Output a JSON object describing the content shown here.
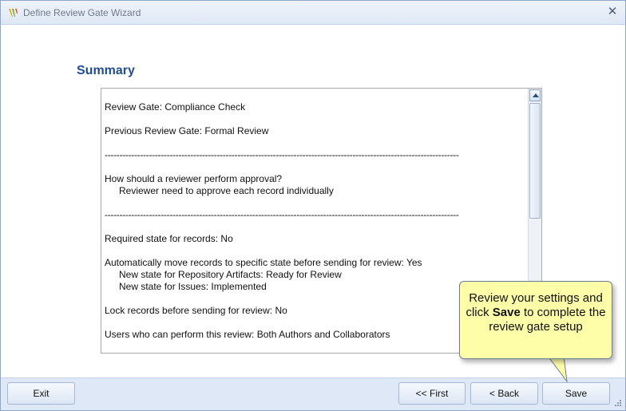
{
  "window": {
    "title": "Define Review Gate Wizard"
  },
  "page": {
    "heading": "Summary"
  },
  "summary": {
    "review_gate": "Review Gate: Compliance Check",
    "previous_gate": "Previous Review Gate: Formal Review",
    "separator": "------------------------------------------------------------------------------------------------------------------------",
    "approval_question": "How should a reviewer perform approval?",
    "approval_answer": "Reviewer need to approve each record individually",
    "required_state": "Required state for records: No",
    "auto_move": "Automatically move records to specific state before sending for review: Yes",
    "new_state_artifacts": "New state for Repository Artifacts: Ready for Review",
    "new_state_issues": "New state for Issues: Implemented",
    "lock_records": "Lock records before sending for review: No",
    "users": "Users who can perform this review: Both Authors and Collaborators"
  },
  "callout": {
    "text_before": "Review your settings and click ",
    "text_bold": "Save",
    "text_after": " to complete the review gate setup"
  },
  "buttons": {
    "exit": "Exit",
    "first": "<< First",
    "back": "< Back",
    "save": "Save"
  },
  "icons": {
    "app": "app-logo-icon",
    "close": "close-icon",
    "grip": "resize-grip-icon"
  },
  "colors": {
    "heading": "#1f4d94",
    "callout_bg": "#fffea8",
    "footer_bg": "#dfe8f6"
  }
}
